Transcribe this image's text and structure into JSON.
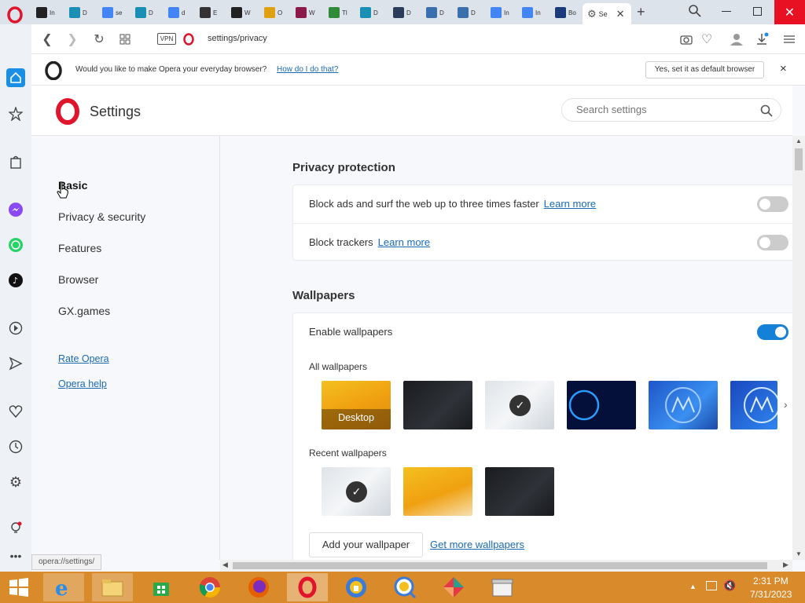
{
  "tabs": [
    {
      "label": "In",
      "icon": "archive-icon",
      "color": "#222"
    },
    {
      "label": "D",
      "icon": "download-icon",
      "color": "#1a8fb5"
    },
    {
      "label": "se",
      "icon": "google-icon",
      "color": "#4285f4"
    },
    {
      "label": "D",
      "icon": "download-icon",
      "color": "#1a8fb5"
    },
    {
      "label": "d",
      "icon": "google-icon",
      "color": "#4285f4"
    },
    {
      "label": "E",
      "icon": "globe-icon",
      "color": "#333"
    },
    {
      "label": "W",
      "icon": "archive-icon",
      "color": "#222"
    },
    {
      "label": "O",
      "icon": "chrome-icon",
      "color": "#e0a010"
    },
    {
      "label": "W",
      "icon": "winrar-icon",
      "color": "#8b1a4a"
    },
    {
      "label": "Tl",
      "icon": "y-icon",
      "color": "#2f8a3a"
    },
    {
      "label": "D",
      "icon": "download-icon",
      "color": "#1a8fb5"
    },
    {
      "label": "D",
      "icon": "q-icon",
      "color": "#2a3d5a"
    },
    {
      "label": "D",
      "icon": "puzzle-icon",
      "color": "#3a6fb0"
    },
    {
      "label": "D",
      "icon": "puzzle-icon",
      "color": "#3a6fb0"
    },
    {
      "label": "In",
      "icon": "google-icon",
      "color": "#4285f4"
    },
    {
      "label": "In",
      "icon": "google-icon",
      "color": "#4285f4"
    },
    {
      "label": "Bo",
      "icon": "booking-icon",
      "color": "#1b3a7a"
    }
  ],
  "active_tab": {
    "label": "Se",
    "icon": "gear-icon"
  },
  "toolbar": {
    "vpn_label": "VPN",
    "address": "settings/privacy"
  },
  "infobar": {
    "message": "Would you like to make Opera your everyday browser?",
    "link": "How do I do that?",
    "button": "Yes, set it as default browser",
    "close": "×"
  },
  "header": {
    "title": "Settings",
    "search_placeholder": "Search settings"
  },
  "nav": {
    "items": [
      "Basic",
      "Privacy & security",
      "Features",
      "Browser",
      "GX.games"
    ],
    "links": [
      "Rate Opera",
      "Opera help"
    ]
  },
  "privacy": {
    "heading": "Privacy protection",
    "block_ads": "Block ads and surf the web up to three times faster",
    "block_trackers": "Block trackers",
    "learn_more": "Learn more",
    "block_ads_enabled": false,
    "block_trackers_enabled": false
  },
  "wallpapers": {
    "heading": "Wallpapers",
    "enable_label": "Enable wallpapers",
    "enabled": true,
    "all_label": "All wallpapers",
    "desktop_label": "Desktop",
    "recent_label": "Recent wallpapers",
    "add_button": "Add your wallpaper",
    "get_more": "Get more wallpapers"
  },
  "status_url": "opera://settings/",
  "clock": {
    "time": "2:31 PM",
    "date": "7/31/2023"
  },
  "colors": {
    "accent": "#1580d8",
    "opera_red": "#e0142b",
    "link": "#1a6ab5",
    "taskbar": "#d98a2a"
  }
}
